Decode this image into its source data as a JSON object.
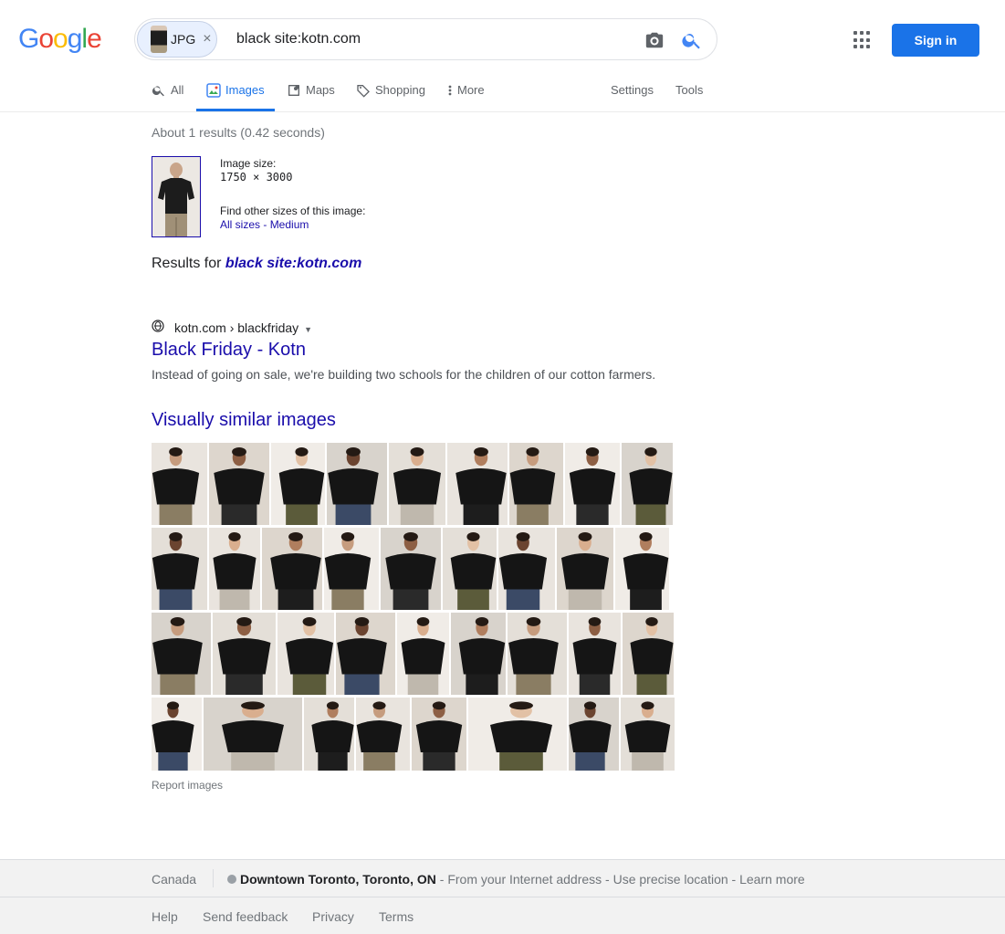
{
  "logo": {
    "text": "Google",
    "colors": [
      "#4285f4",
      "#ea4335",
      "#fbbc05",
      "#4285f4",
      "#34a853",
      "#ea4335"
    ]
  },
  "search": {
    "chip_label": "JPG",
    "chip_close": "×",
    "query": "black site:kotn.com"
  },
  "header": {
    "signin_label": "Sign in"
  },
  "tabs": {
    "items": [
      {
        "label": "All",
        "icon": "search-icon"
      },
      {
        "label": "Images",
        "icon": "image-icon",
        "active": true
      },
      {
        "label": "Maps",
        "icon": "map-icon"
      },
      {
        "label": "Shopping",
        "icon": "tag-icon"
      },
      {
        "label": "More",
        "icon": "more-vertical-icon"
      }
    ],
    "settings": "Settings",
    "tools": "Tools"
  },
  "results": {
    "stats": "About 1 results (0.42 seconds)",
    "image_size_label": "Image size:",
    "image_size_value": "1750 × 3000",
    "other_sizes_label": "Find other sizes of this image:",
    "all_sizes": "All sizes",
    "sep": " - ",
    "medium": "Medium",
    "results_for_prefix": "Results for ",
    "results_for_query": "black site:kotn.com"
  },
  "result": {
    "breadcrumb": "kotn.com › blackfriday",
    "title": "Black Friday - Kotn",
    "snippet": "Instead of going on sale, we're building two schools for the children of our cotton farmers."
  },
  "similar": {
    "heading": "Visually similar images",
    "report": "Report images"
  },
  "footer": {
    "country": "Canada",
    "location_bold": "Downtown Toronto, Toronto, ON",
    "location_rest": " - From your Internet address - Use precise location - Learn more",
    "links": [
      "Help",
      "Send feedback",
      "Privacy",
      "Terms"
    ]
  },
  "colors": {
    "accent": "#1a73e8",
    "link": "#1a0dab",
    "footer_bg": "#f2f2f2"
  }
}
